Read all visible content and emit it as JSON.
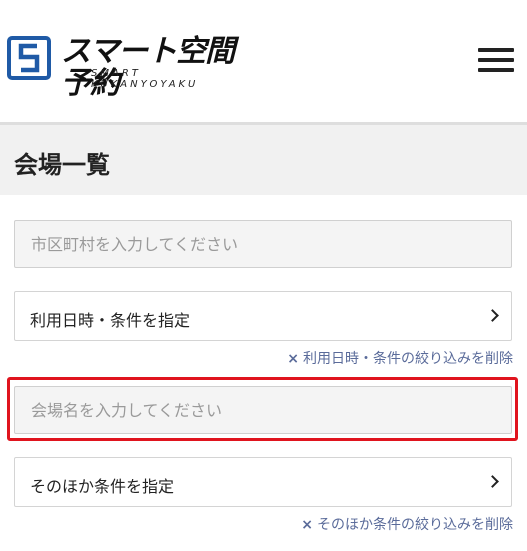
{
  "header": {
    "logo_text": "スマート空間予約",
    "logo_subtext": "SMART KUKANYOYAKU",
    "logo_color": "#1f5aa6",
    "menu_icon": "hamburger-menu-icon"
  },
  "page": {
    "title": "会場一覧"
  },
  "search": {
    "city_placeholder": "市区町村を入力してください",
    "venue_placeholder": "会場名を入力してください"
  },
  "filters": {
    "datetime_label": "利用日時・条件を指定",
    "datetime_clear": "利用日時・条件の絞り込みを削除",
    "other_label": "そのほか条件を指定",
    "other_clear": "そのほか条件の絞り込みを削除",
    "clear_icon": "×",
    "chevron_icon": "chevron-right-icon"
  },
  "colors": {
    "highlight": "#e0141e",
    "link": "#5a6b9a",
    "title_band": "#f1f1f1"
  }
}
